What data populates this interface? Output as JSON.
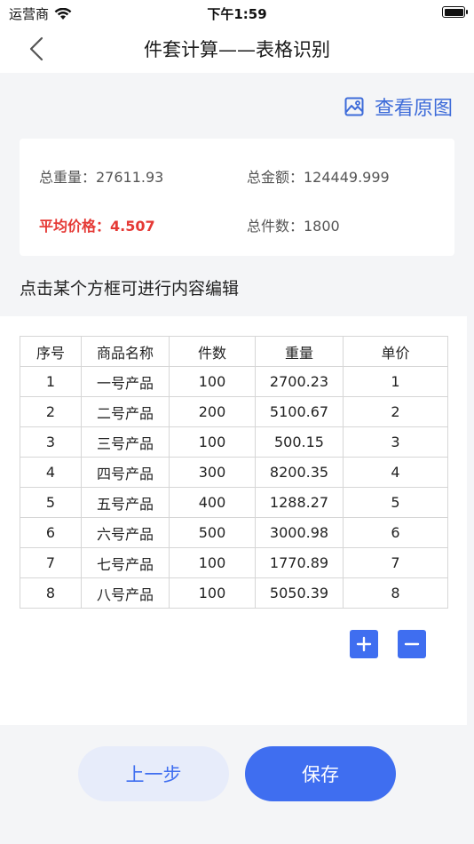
{
  "status_bar": {
    "carrier": "运营商",
    "time": "下午1:59"
  },
  "nav": {
    "title": "件套计算——表格识别",
    "back_icon": "chevron-left-icon"
  },
  "view_original": {
    "label": "查看原图",
    "icon": "image-icon"
  },
  "summary": {
    "total_weight": "总重量：27611.93",
    "total_amount": "总金额：124449.999",
    "avg_price": "平均价格：4.507",
    "total_pieces": "总件数：1800"
  },
  "hint": "点击某个方框可进行内容编辑",
  "table": {
    "headers": [
      "序号",
      "商品名称",
      "件数",
      "重量",
      "单价"
    ],
    "rows": [
      [
        "1",
        "一号产品",
        "100",
        "2700.23",
        "1"
      ],
      [
        "2",
        "二号产品",
        "200",
        "5100.67",
        "2"
      ],
      [
        "3",
        "三号产品",
        "100",
        "500.15",
        "3"
      ],
      [
        "4",
        "四号产品",
        "300",
        "8200.35",
        "4"
      ],
      [
        "5",
        "五号产品",
        "400",
        "1288.27",
        "5"
      ],
      [
        "6",
        "六号产品",
        "500",
        "3000.98",
        "6"
      ],
      [
        "7",
        "七号产品",
        "100",
        "1770.89",
        "7"
      ],
      [
        "8",
        "八号产品",
        "100",
        "5050.39",
        "8"
      ]
    ]
  },
  "buttons": {
    "prev": "上一步",
    "save": "保存"
  },
  "colors": {
    "accent": "#3f6ef0",
    "link": "#3d6bd9",
    "warning": "#e53935"
  }
}
